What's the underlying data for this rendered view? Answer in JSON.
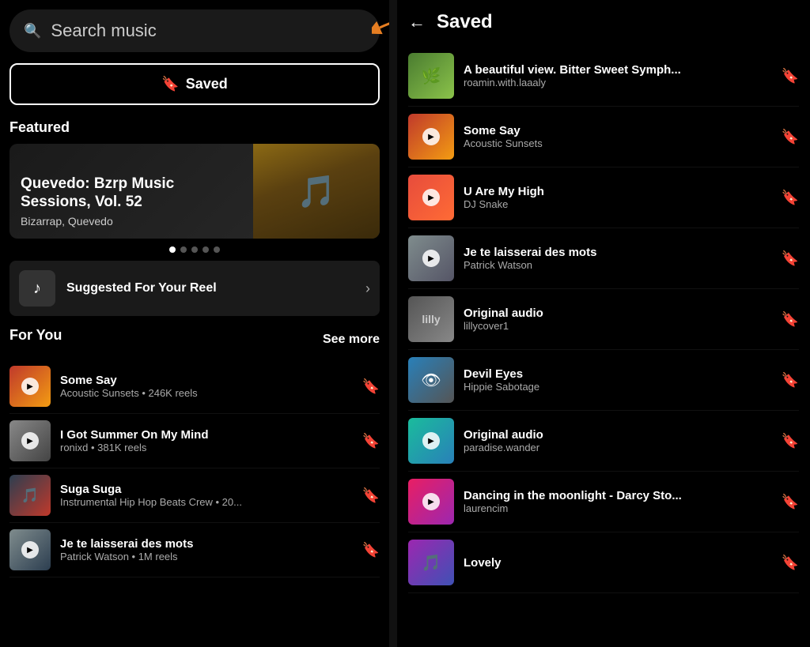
{
  "left": {
    "search": {
      "placeholder": "Search music"
    },
    "saved_button": "Saved",
    "featured": {
      "label": "Featured",
      "title": "Quevedo: Bzrp Music Sessions, Vol. 52",
      "subtitle": "Bizarrap, Quevedo",
      "dots": [
        true,
        false,
        false,
        false,
        false
      ]
    },
    "suggested": {
      "label": "Suggested For Your Reel",
      "icon": "♪"
    },
    "for_you": {
      "label": "For You",
      "see_more": "See more",
      "items": [
        {
          "title": "Some Say",
          "sub": "Acoustic Sunsets • 246K reels",
          "thumb_class": "thumb-some-say",
          "has_play": true
        },
        {
          "title": "I Got Summer On My Mind",
          "sub": "ronixd • 381K reels",
          "thumb_class": "thumb-summer",
          "has_play": true
        },
        {
          "title": "Suga Suga",
          "sub": "Instrumental Hip Hop Beats Crew • 20...",
          "thumb_class": "thumb-suga",
          "has_play": false
        },
        {
          "title": "Je te laisserai des mots",
          "sub": "Patrick Watson • 1M reels",
          "thumb_class": "thumb-je-te",
          "has_play": true
        }
      ]
    }
  },
  "right": {
    "back_label": "←",
    "title": "Saved",
    "items": [
      {
        "title": "A beautiful view. Bitter Sweet Symph...",
        "sub": "roamin.with.laaaly",
        "thumb_class": "t-beautiful",
        "has_play": false
      },
      {
        "title": "Some Say",
        "sub": "Acoustic Sunsets",
        "thumb_class": "t-some-say",
        "has_play": true
      },
      {
        "title": "U Are My High",
        "sub": "DJ Snake",
        "thumb_class": "t-u-are",
        "has_play": true
      },
      {
        "title": "Je te laisserai des mots",
        "sub": "Patrick Watson",
        "thumb_class": "t-je-te",
        "has_play": true
      },
      {
        "title": "Original audio",
        "sub": "lillycover1",
        "thumb_class": "t-original1",
        "has_play": false
      },
      {
        "title": "Devil Eyes",
        "sub": "Hippie Sabotage",
        "thumb_class": "t-devil",
        "has_play": false
      },
      {
        "title": "Original audio",
        "sub": "paradise.wander",
        "thumb_class": "t-original2",
        "has_play": true
      },
      {
        "title": "Dancing in the moonlight - Darcy Sto...",
        "sub": "laurencim",
        "thumb_class": "t-dancing",
        "has_play": true
      },
      {
        "title": "Lovely",
        "sub": "",
        "thumb_class": "t-lovely",
        "has_play": false
      }
    ]
  }
}
